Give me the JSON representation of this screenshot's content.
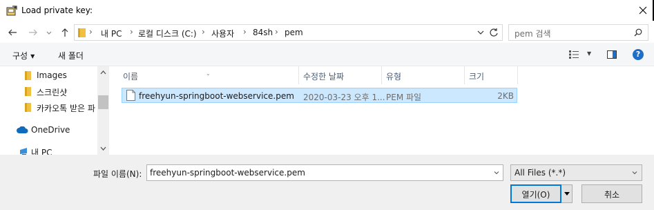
{
  "window": {
    "title": "Load private key:"
  },
  "address": {
    "crumbs": [
      "내 PC",
      "로컬 디스크 (C:)",
      "사용자",
      "84sh",
      "pem"
    ],
    "search_placeholder": "pem 검색"
  },
  "toolbar": {
    "organize_label": "구성",
    "new_folder_label": "새 폴더"
  },
  "nav_pane": {
    "items": [
      {
        "label": "Images",
        "icon": "folder-icon"
      },
      {
        "label": "스크린샷",
        "icon": "folder-icon"
      },
      {
        "label": "카카오톡 받은 파",
        "icon": "folder-icon"
      },
      {
        "label": "OneDrive",
        "icon": "cloud-icon"
      },
      {
        "label": "내 PC",
        "icon": "computer-icon"
      }
    ]
  },
  "file_list": {
    "columns": [
      "이름",
      "수정한 날짜",
      "유형",
      "크기"
    ],
    "rows": [
      {
        "name": "freehyun-springboot-webservice.pem",
        "modified": "2020-03-23 오후 1...",
        "type": "PEM 파일",
        "size": "2KB",
        "selected": true
      }
    ]
  },
  "bottom": {
    "filename_label": "파일 이름(N):",
    "filename_value": "freehyun-springboot-webservice.pem",
    "filetype_value": "All Files (*.*)",
    "open_label": "열기(O)",
    "cancel_label": "취소"
  },
  "colors": {
    "selection": "#cce8ff",
    "selection_border": "#99d1ff",
    "accent": "#0078d7",
    "folder": "#f0c040"
  }
}
